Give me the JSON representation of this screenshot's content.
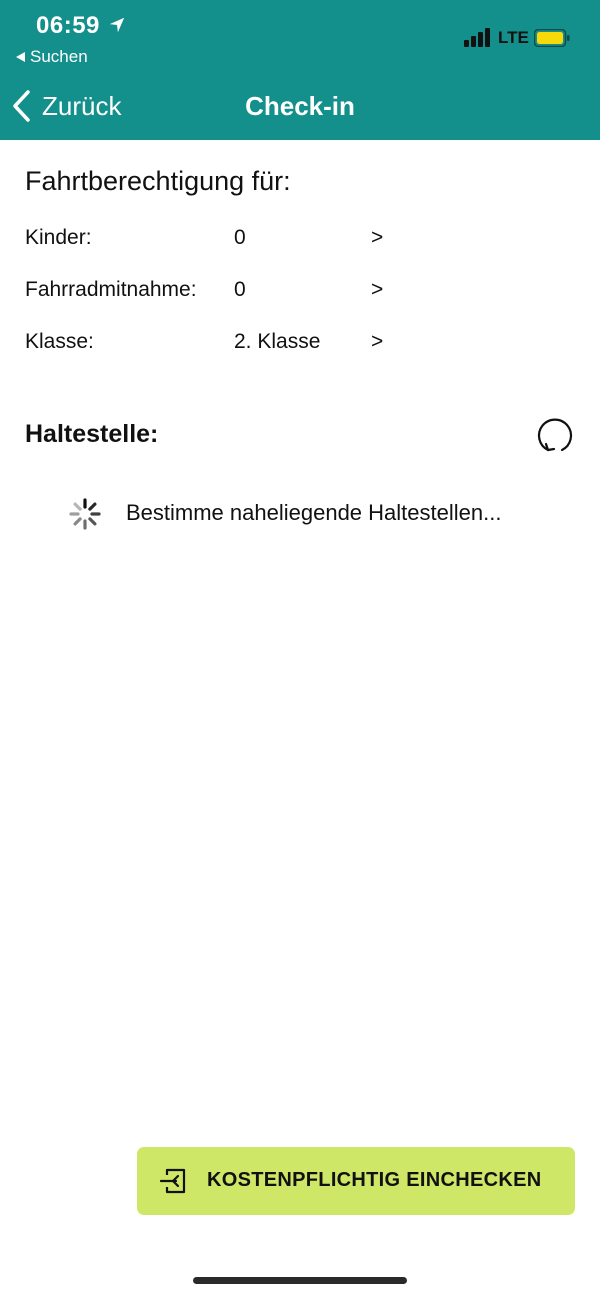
{
  "status_bar": {
    "time": "06:59",
    "back_app_label": "Suchen",
    "network": "LTE",
    "battery_color": "#f5d90a",
    "location_icon": "location-arrow-icon"
  },
  "nav": {
    "back_label": "Zurück",
    "title": "Check-in",
    "bar_color": "#14908c"
  },
  "entitlement": {
    "title": "Fahrtberechtigung für:",
    "rows": [
      {
        "label": "Kinder:",
        "value": "0",
        "chevron": ">"
      },
      {
        "label": "Fahrradmitnahme:",
        "value": "0",
        "chevron": ">"
      },
      {
        "label": "Klasse:",
        "value": "2. Klasse",
        "chevron": ">"
      }
    ]
  },
  "stop": {
    "title": "Haltestelle:",
    "refresh_icon": "refresh-icon",
    "loading_text": "Bestimme naheliegende Haltestellen..."
  },
  "checkin_button": {
    "label": "KOSTENPFLICHTIG EINCHECKEN",
    "icon": "sign-in-icon",
    "color": "#cfe766"
  }
}
